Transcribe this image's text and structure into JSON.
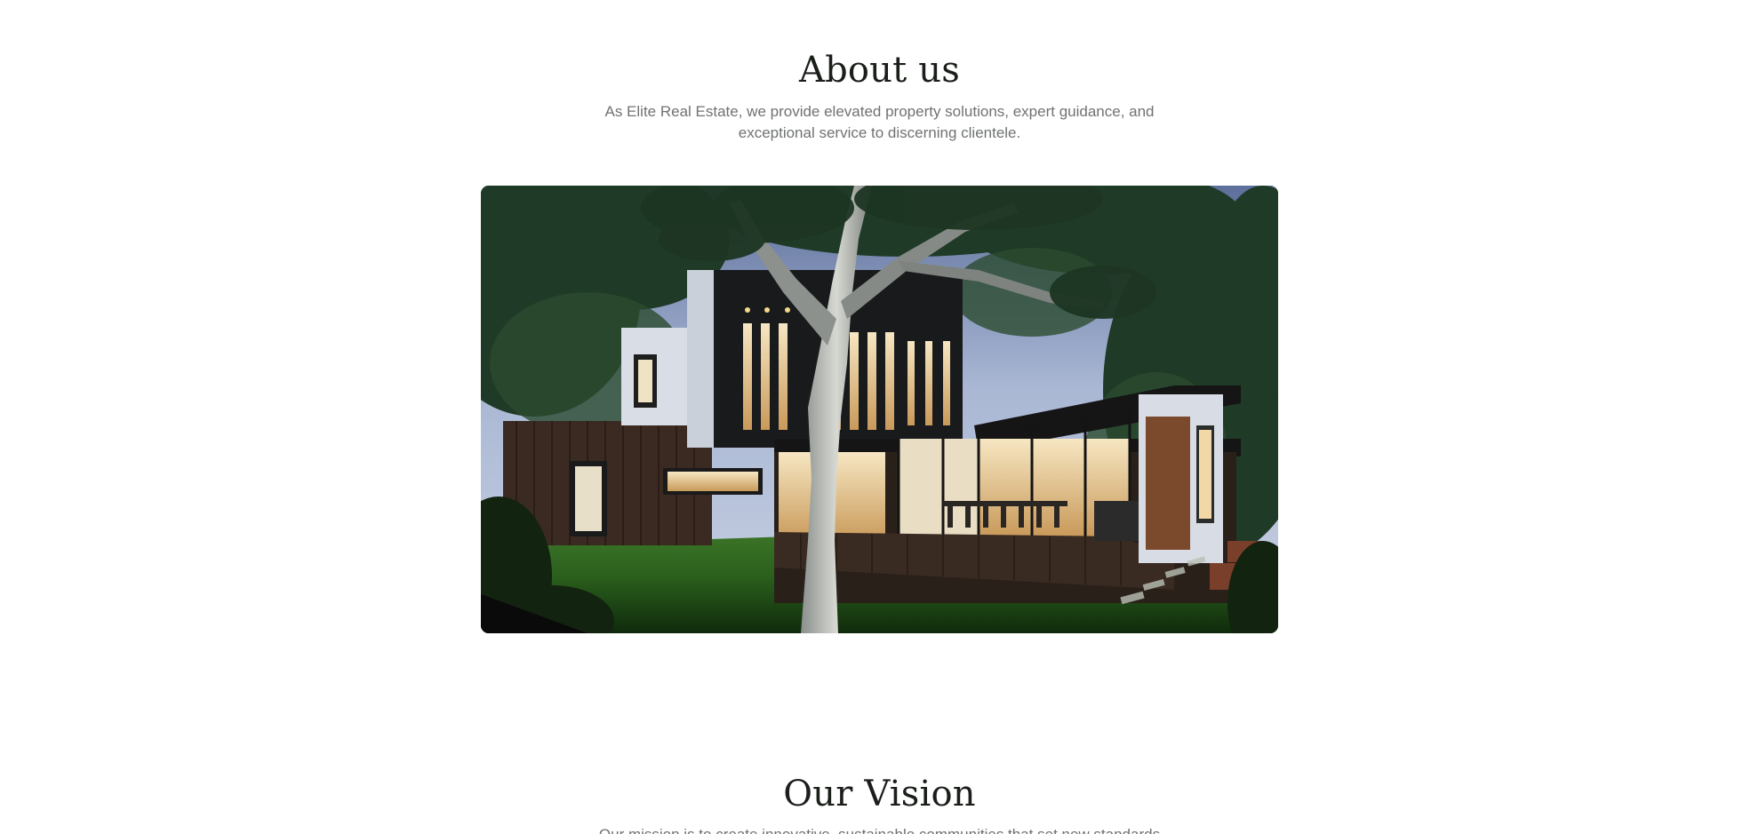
{
  "about": {
    "title": "About us",
    "description": "As Elite Real Estate, we provide elevated property solutions, expert guidance, and exceptional service to discerning clientele."
  },
  "hero_image": {
    "subject": "modern two-storey house at dusk with large tree and lawn"
  },
  "vision": {
    "title": "Our Vision",
    "description": "Our mission is to create innovative, sustainable communities that set new standards"
  },
  "colors": {
    "heading": "#1b1f1a",
    "body_text": "#6f7370",
    "background": "#ffffff"
  }
}
